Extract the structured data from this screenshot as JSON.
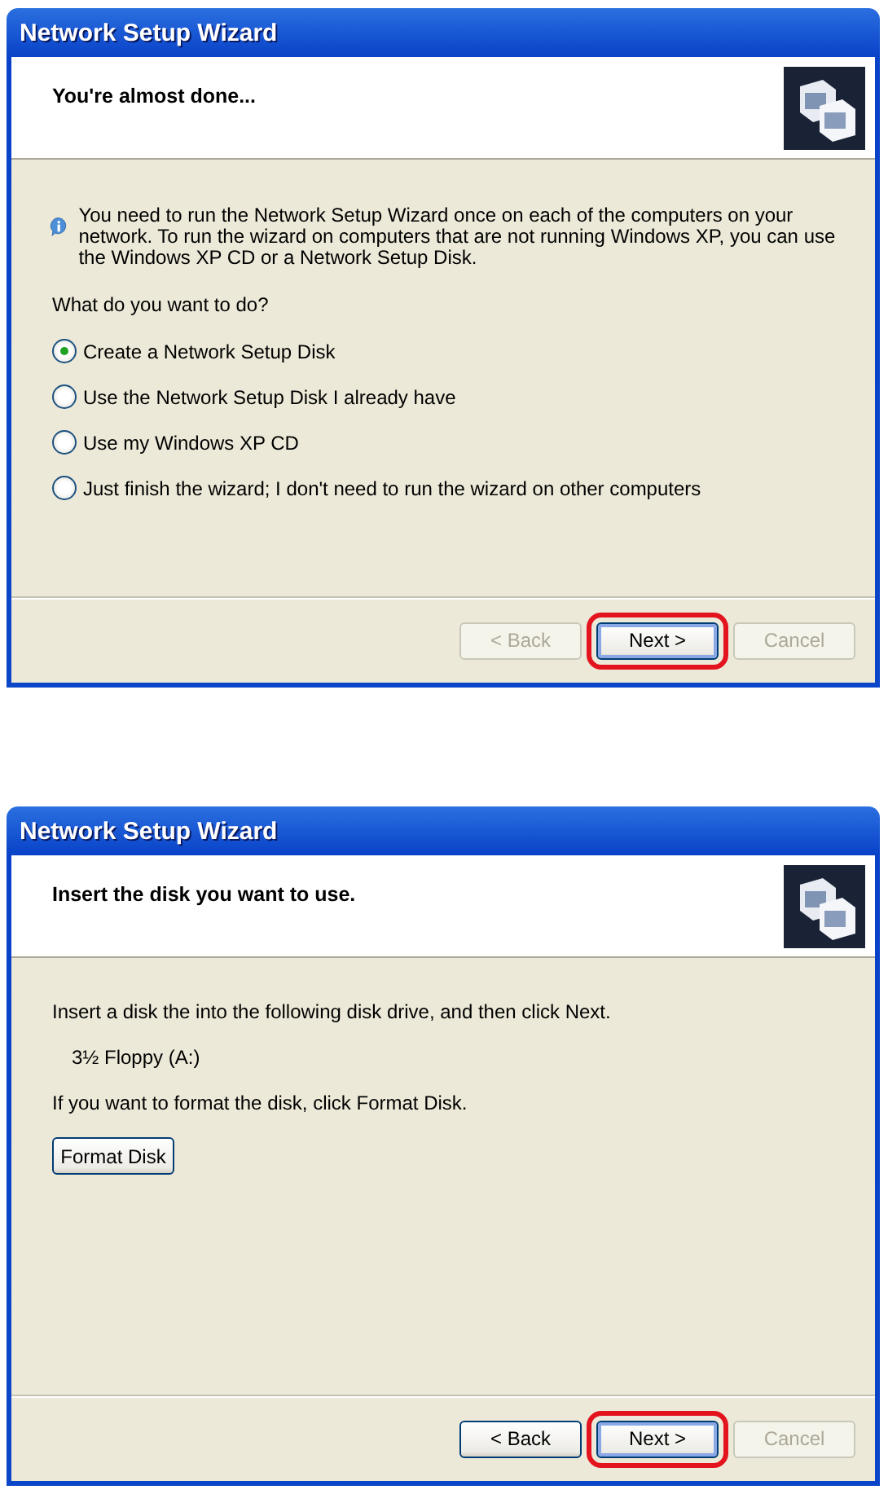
{
  "dialogs": [
    {
      "title": "Network Setup Wizard",
      "heading": "You're almost done...",
      "body": [
        {
          "kind": "info",
          "text": "You need to run the Network Setup Wizard once on each of the computers on your network. To run the wizard on computers that are not running Windows XP, you can use the Windows XP CD or a Network Setup Disk."
        },
        {
          "kind": "text",
          "text": "What do you want to do?"
        },
        {
          "kind": "radio",
          "text": "Create a Network Setup Disk",
          "selected": true
        },
        {
          "kind": "radio",
          "text": "Use the Network Setup Disk I already have",
          "selected": false
        },
        {
          "kind": "radio",
          "text": "Use my Windows XP CD",
          "selected": false
        },
        {
          "kind": "radio",
          "text": "Just finish the wizard; I don't need to run the wizard on other computers",
          "selected": false
        }
      ],
      "buttons": [
        {
          "label": "< Back",
          "disabled": true,
          "default": false,
          "highlighted": false
        },
        {
          "label": "Next >",
          "disabled": false,
          "default": true,
          "highlighted": true
        },
        {
          "label": "Cancel",
          "disabled": true,
          "default": false,
          "highlighted": false
        }
      ]
    },
    {
      "title": "Network Setup Wizard",
      "heading": "Insert the disk you want to use.",
      "body": [
        {
          "kind": "text",
          "text": "Insert a disk the into the following disk drive, and then click Next."
        },
        {
          "kind": "drive",
          "text": "3½ Floppy (A:)"
        },
        {
          "kind": "text",
          "text": "If you want to format the disk, click Format Disk."
        },
        {
          "kind": "button",
          "text": "Format Disk"
        }
      ],
      "buttons": [
        {
          "label": "< Back",
          "disabled": false,
          "default": false,
          "highlighted": false
        },
        {
          "label": "Next >",
          "disabled": false,
          "default": true,
          "highlighted": true
        },
        {
          "label": "Cancel",
          "disabled": true,
          "default": false,
          "highlighted": false
        }
      ]
    }
  ]
}
